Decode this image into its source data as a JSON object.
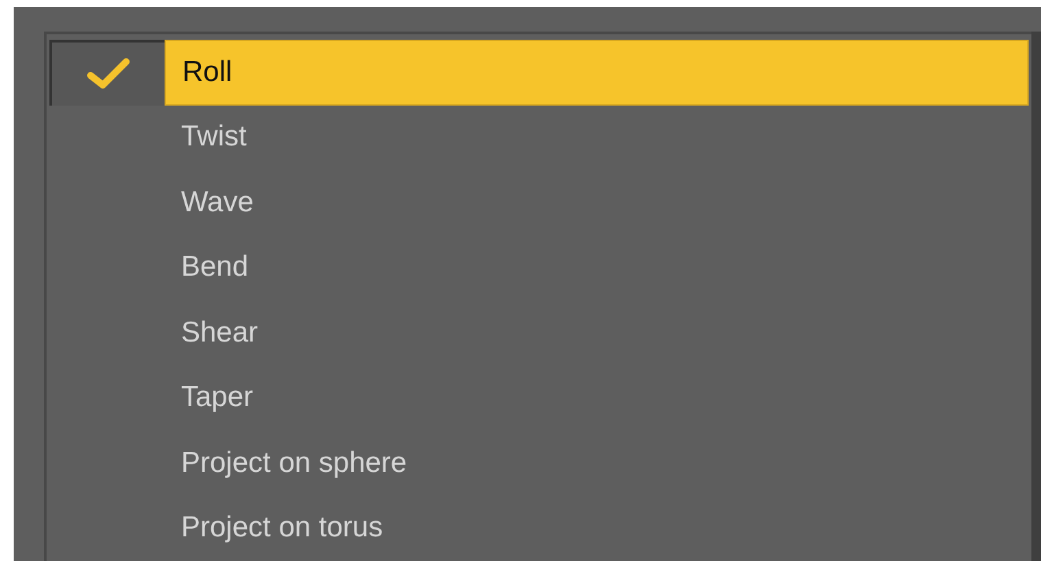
{
  "menu": {
    "items": [
      {
        "label": "Roll",
        "checked": true,
        "selected": true
      },
      {
        "label": "Twist",
        "checked": false,
        "selected": false
      },
      {
        "label": "Wave",
        "checked": false,
        "selected": false
      },
      {
        "label": "Bend",
        "checked": false,
        "selected": false
      },
      {
        "label": "Shear",
        "checked": false,
        "selected": false
      },
      {
        "label": "Taper",
        "checked": false,
        "selected": false
      },
      {
        "label": "Project on sphere",
        "checked": false,
        "selected": false
      },
      {
        "label": "Project on torus",
        "checked": false,
        "selected": false
      }
    ]
  }
}
